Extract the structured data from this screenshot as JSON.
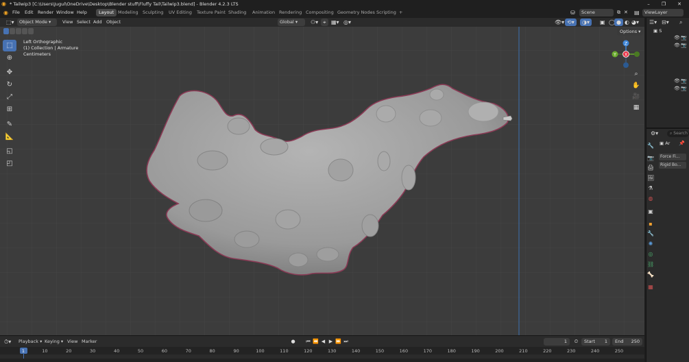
{
  "window": {
    "title": "* Tailwip3 [C:\\Users\\Jugul\\OneDrive\\Desktop\\Blender stuff\\Fluffy Tail\\Tailwip3.blend] - Blender 4.2.3 LTS",
    "minimize": "–",
    "maximize": "❐",
    "close": "✕"
  },
  "menus": [
    "File",
    "Edit",
    "Render",
    "Window",
    "Help"
  ],
  "workspaces": [
    "Layout",
    "Modeling",
    "Sculpting",
    "UV Editing",
    "Texture Paint",
    "Shading",
    "Animation",
    "Rendering",
    "Compositing",
    "Geometry Nodes",
    "Scripting",
    "+"
  ],
  "active_workspace": "Layout",
  "scene": {
    "label": "Scene",
    "view_layer": "ViewLayer"
  },
  "viewport_header": {
    "mode": "Object Mode",
    "menus": [
      "View",
      "Select",
      "Add",
      "Object"
    ],
    "orientation": "Global",
    "options": "Options"
  },
  "viewport_info": {
    "view": "Left Orthographic",
    "collection": "(1) Collection | Armature",
    "units": "Centimeters"
  },
  "gizmo": {
    "x": "X",
    "y": "Y",
    "z": "Z"
  },
  "outliner": {
    "rows": [
      "S"
    ]
  },
  "properties": {
    "search_placeholder": "Search",
    "object_label": "Ar",
    "buttons": [
      "Force Fi...",
      "Rigid Bo..."
    ]
  },
  "timeline": {
    "menus": [
      "Playback",
      "Keying",
      "View",
      "Marker"
    ],
    "current_frame": "1",
    "start_label": "Start",
    "start": "1",
    "end_label": "End",
    "end": "250",
    "ticks": [
      "1",
      "10",
      "20",
      "30",
      "40",
      "50",
      "60",
      "70",
      "80",
      "90",
      "100",
      "110",
      "120",
      "130",
      "140",
      "150",
      "160",
      "170",
      "180",
      "190",
      "200",
      "210",
      "220",
      "230",
      "240",
      "250"
    ]
  },
  "colors": {
    "accent": "#4772b3",
    "viewport_bg": "#3c3c3c",
    "selection_outline": "#8a3a55",
    "axis_x": "#e8364a",
    "axis_y": "#6bab2e",
    "axis_z": "#3d85d8"
  }
}
